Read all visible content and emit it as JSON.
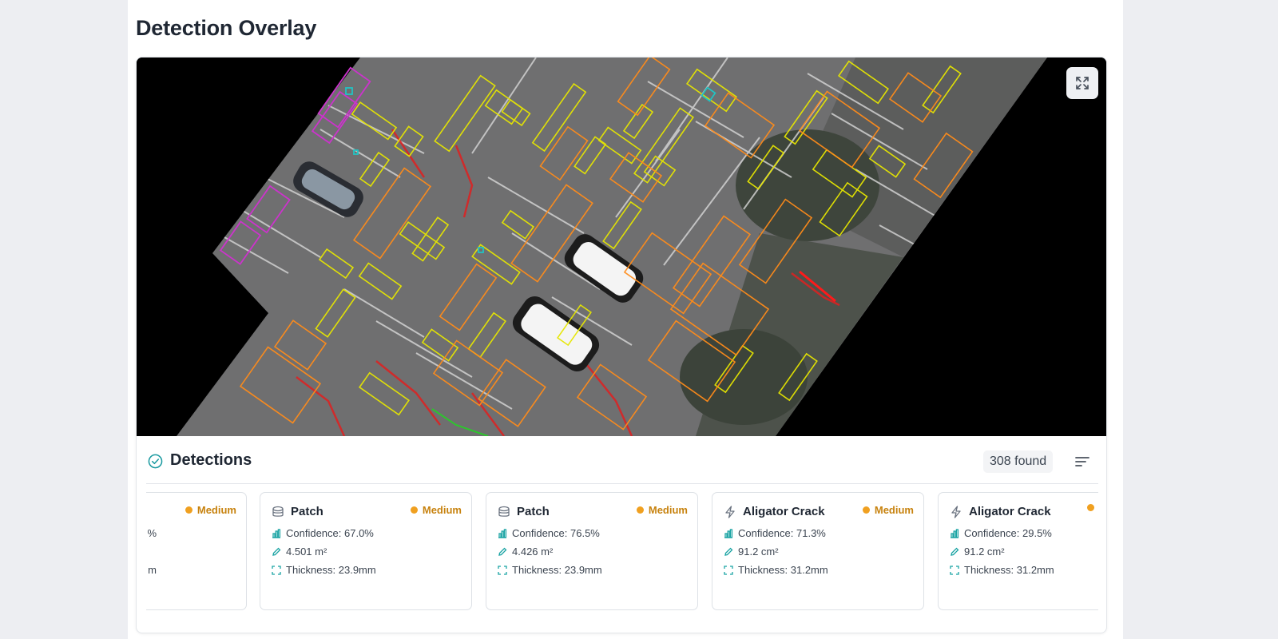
{
  "page": {
    "title": "Detection Overlay"
  },
  "overlay": {
    "expand_icon": "expand-icon",
    "class_colors": {
      "aligator_crack": "#e6e600",
      "patch": "#ff8c1a",
      "crack": "#ff1a1a",
      "pothole": "#cc33cc",
      "marker": "#22c2c2",
      "other": "#2ec42e"
    }
  },
  "detections": {
    "title": "Detections",
    "count_label": "308 found",
    "status_icon": "check-circle-icon",
    "sort_icon": "sort-lines-icon",
    "items": [
      {
        "type": "",
        "icon": "patch-icon",
        "severity": "Medium",
        "confidence": "%",
        "area": "",
        "thickness": "m"
      },
      {
        "type": "Patch",
        "icon": "patch-icon",
        "severity": "Medium",
        "confidence": "Confidence: 67.0%",
        "area": "4.501 m²",
        "thickness": "Thickness: 23.9mm"
      },
      {
        "type": "Patch",
        "icon": "patch-icon",
        "severity": "Medium",
        "confidence": "Confidence: 76.5%",
        "area": "4.426 m²",
        "thickness": "Thickness: 23.9mm"
      },
      {
        "type": "Aligator Crack",
        "icon": "lightning-icon",
        "severity": "Medium",
        "confidence": "Confidence: 71.3%",
        "area": "91.2 cm²",
        "thickness": "Thickness: 31.2mm"
      },
      {
        "type": "Aligator Crack",
        "icon": "lightning-icon",
        "severity": "",
        "confidence": "Confidence: 29.5%",
        "area": "91.2 cm²",
        "thickness": "Thickness: 31.2mm"
      }
    ],
    "colors": {
      "severity_medium": "#f0a020",
      "metric_icon": "#19a3a3"
    }
  }
}
